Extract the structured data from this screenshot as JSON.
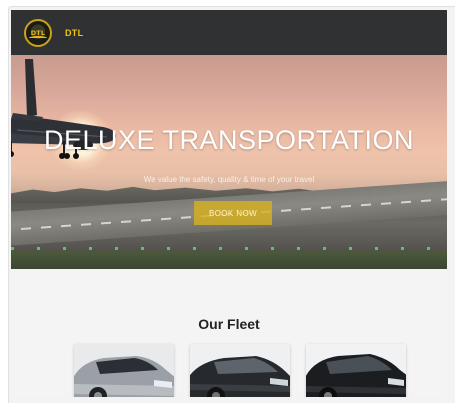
{
  "navbar": {
    "logo_text": "DTL",
    "brand": "DTL"
  },
  "hero": {
    "title": "DELUXE TRANSPORTATION",
    "subtitle": "We value the safety, quality & time of your travel",
    "cta_label": "BOOK NOW"
  },
  "fleet": {
    "title": "Our Fleet",
    "cars": [
      {
        "name": "silver-sedan"
      },
      {
        "name": "black-sedan"
      },
      {
        "name": "black-luxury-sedan"
      }
    ]
  },
  "colors": {
    "navbar_bg": "#2f3133",
    "brand": "#f1c40f",
    "cta_bg": "#d6b01e",
    "page_bg": "#f4f4f4"
  }
}
